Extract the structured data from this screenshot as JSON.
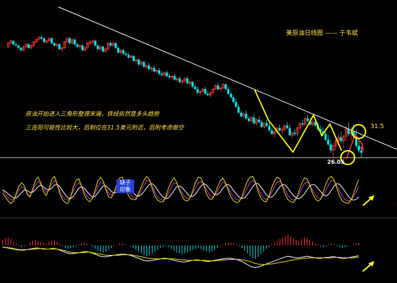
{
  "title": "美原油日线图 —— 于韦斌",
  "annotations": {
    "line1": "原油开始进入三角形整理末端，铁线依然是多头趋势",
    "line2": "三连阳可能性比较大，后制位在31.5美元附近，后附考虑做空"
  },
  "levels": {
    "resistance": "31.5",
    "support": "26.05"
  },
  "badge": {
    "top": "缺子",
    "bottom": "印象"
  },
  "colors": {
    "background": "#000000",
    "up_candle": "#ff3b3b",
    "down_candle": "#00e5e5",
    "trendline": "#ffffff",
    "zigzag": "#ffff00",
    "text": "#ffe14a",
    "gridline": "#7a0000",
    "kdj_k": "#cc33cc",
    "kdj_d": "#ffffff",
    "kdj_j": "#e6e600",
    "macd_pos": "#ff3b3b",
    "macd_neg": "#00e5e5",
    "arrow": "#ffff00"
  },
  "chart_data": {
    "type": "candlestick",
    "candles": [
      [
        4,
        8,
        3,
        7
      ],
      [
        7,
        10,
        6,
        9
      ],
      [
        9,
        9,
        5,
        6
      ],
      [
        6,
        8,
        4,
        5
      ],
      [
        5,
        6,
        2,
        3
      ],
      [
        3,
        4,
        0,
        1
      ],
      [
        1,
        5,
        0,
        4
      ],
      [
        4,
        7,
        3,
        6
      ],
      [
        6,
        7,
        2,
        3
      ],
      [
        3,
        6,
        2,
        5
      ],
      [
        5,
        9,
        4,
        8
      ],
      [
        8,
        11,
        7,
        10
      ],
      [
        10,
        13,
        9,
        12
      ],
      [
        12,
        14,
        10,
        11
      ],
      [
        11,
        12,
        7,
        8
      ],
      [
        8,
        10,
        6,
        9
      ],
      [
        9,
        12,
        8,
        11
      ],
      [
        11,
        12,
        6,
        7
      ],
      [
        7,
        8,
        4,
        5
      ],
      [
        5,
        7,
        3,
        6
      ],
      [
        6,
        7,
        1,
        2
      ],
      [
        2,
        4,
        0,
        3
      ],
      [
        3,
        9,
        2,
        8
      ],
      [
        8,
        12,
        7,
        11
      ],
      [
        11,
        12,
        6,
        7
      ],
      [
        7,
        11,
        6,
        10
      ],
      [
        10,
        11,
        5,
        6
      ],
      [
        6,
        7,
        3,
        4
      ],
      [
        4,
        6,
        2,
        5
      ],
      [
        5,
        6,
        0,
        1
      ],
      [
        1,
        4,
        0,
        3
      ],
      [
        3,
        8,
        2,
        7
      ],
      [
        7,
        9,
        5,
        8
      ],
      [
        8,
        10,
        6,
        9
      ],
      [
        9,
        10,
        4,
        5
      ],
      [
        5,
        6,
        1,
        2
      ],
      [
        2,
        5,
        1,
        4
      ],
      [
        4,
        5,
        -1,
        0
      ],
      [
        0,
        3,
        -1,
        2
      ],
      [
        2,
        8,
        1,
        7
      ],
      [
        7,
        9,
        4,
        5
      ],
      [
        5,
        8,
        4,
        7
      ],
      [
        7,
        8,
        2,
        3
      ],
      [
        3,
        4,
        -2,
        -1
      ],
      [
        -1,
        2,
        -2,
        1
      ],
      [
        1,
        2,
        -3,
        -2
      ],
      [
        -2,
        0,
        -4,
        -3
      ],
      [
        -3,
        -1,
        -6,
        -5
      ],
      [
        -5,
        -3,
        -6,
        -4
      ],
      [
        -4,
        -3,
        -9,
        -8
      ],
      [
        -8,
        -6,
        -10,
        -7
      ],
      [
        -7,
        -6,
        -12,
        -11
      ],
      [
        -11,
        -8,
        -12,
        -9
      ],
      [
        -9,
        -8,
        -14,
        -13
      ],
      [
        -13,
        -11,
        -15,
        -12
      ],
      [
        -12,
        -10,
        -16,
        -15
      ],
      [
        -15,
        -13,
        -17,
        -14
      ],
      [
        -14,
        -12,
        -18,
        -17
      ],
      [
        -17,
        -15,
        -19,
        -16
      ],
      [
        -16,
        -14,
        -20,
        -19
      ],
      [
        -19,
        -17,
        -21,
        -20
      ],
      [
        -20,
        -17,
        -22,
        -18
      ],
      [
        -18,
        -16,
        -22,
        -21
      ],
      [
        -21,
        -19,
        -23,
        -22
      ],
      [
        -22,
        -20,
        -24,
        -21
      ],
      [
        -21,
        -19,
        -25,
        -24
      ],
      [
        -24,
        -22,
        -26,
        -23
      ],
      [
        -23,
        -21,
        -27,
        -26
      ],
      [
        -26,
        -24,
        -28,
        -25
      ],
      [
        -25,
        -22,
        -27,
        -23
      ],
      [
        -23,
        -21,
        -28,
        -27
      ],
      [
        -27,
        -25,
        -29,
        -26
      ],
      [
        -26,
        -25,
        -31,
        -30
      ],
      [
        -30,
        -28,
        -33,
        -32
      ],
      [
        -32,
        -30,
        -36,
        -35
      ],
      [
        -35,
        -33,
        -37,
        -34
      ],
      [
        -34,
        -31,
        -35,
        -32
      ],
      [
        -32,
        -30,
        -37,
        -36
      ],
      [
        -36,
        -34,
        -38,
        -37
      ],
      [
        -37,
        -34,
        -39,
        -35
      ],
      [
        -35,
        -31,
        -36,
        -32
      ],
      [
        -32,
        -28,
        -33,
        -29
      ],
      [
        -29,
        -27,
        -33,
        -32
      ],
      [
        -32,
        -30,
        -34,
        -31
      ],
      [
        -31,
        -27,
        -32,
        -28
      ],
      [
        -28,
        -27,
        -33,
        -32
      ],
      [
        -32,
        -30,
        -37,
        -36
      ],
      [
        -36,
        -34,
        -40,
        -39
      ],
      [
        -39,
        -37,
        -44,
        -43
      ],
      [
        -43,
        -40,
        -48,
        -47
      ],
      [
        -47,
        -45,
        -53,
        -52
      ],
      [
        -52,
        -50,
        -56,
        -55
      ],
      [
        -55,
        -52,
        -57,
        -53
      ],
      [
        -53,
        -50,
        -58,
        -57
      ],
      [
        -57,
        -55,
        -60,
        -59
      ],
      [
        -59,
        -55,
        -60,
        -56
      ],
      [
        -56,
        -53,
        -62,
        -61
      ],
      [
        -61,
        -57,
        -63,
        -58
      ],
      [
        -58,
        -55,
        -61,
        -60
      ],
      [
        -60,
        -58,
        -65,
        -64
      ],
      [
        -64,
        -60,
        -66,
        -61
      ],
      [
        -61,
        -58,
        -64,
        -63
      ],
      [
        -63,
        -60,
        -68,
        -67
      ],
      [
        -67,
        -65,
        -71,
        -70
      ],
      [
        -70,
        -67,
        -73,
        -68
      ],
      [
        -68,
        -64,
        -70,
        -65
      ],
      [
        -65,
        -62,
        -68,
        -67
      ],
      [
        -67,
        -64,
        -70,
        -66
      ],
      [
        -66,
        -62,
        -68,
        -63
      ],
      [
        -63,
        -60,
        -66,
        -65
      ],
      [
        -65,
        -62,
        -72,
        -71
      ],
      [
        -71,
        -68,
        -74,
        -69
      ],
      [
        -69,
        -66,
        -72,
        -70
      ],
      [
        -70,
        -64,
        -72,
        -65
      ],
      [
        -65,
        -60,
        -67,
        -61
      ],
      [
        -61,
        -58,
        -64,
        -62
      ],
      [
        -62,
        -56,
        -63,
        -57
      ],
      [
        -57,
        -54,
        -60,
        -59
      ],
      [
        -59,
        -57,
        -63,
        -62
      ],
      [
        -62,
        -58,
        -64,
        -60
      ],
      [
        -60,
        -57,
        -64,
        -63
      ],
      [
        -63,
        -60,
        -68,
        -66
      ],
      [
        -66,
        -63,
        -70,
        -68
      ],
      [
        -68,
        -64,
        -72,
        -70
      ],
      [
        -70,
        -66,
        -76,
        -75
      ],
      [
        -75,
        -71,
        -80,
        -79
      ],
      [
        -79,
        -75,
        -86,
        -84
      ],
      [
        -84,
        -78,
        -90,
        -80
      ],
      [
        -80,
        -74,
        -84,
        -76
      ],
      [
        -76,
        -70,
        -80,
        -73
      ],
      [
        -73,
        -68,
        -78,
        -76
      ],
      [
        -76,
        -71,
        -82,
        -72
      ],
      [
        -72,
        -64,
        -76,
        -66
      ],
      [
        -66,
        -60,
        -72,
        -70
      ],
      [
        -70,
        -64,
        -76,
        -68
      ],
      [
        -68,
        -62,
        -74,
        -72
      ],
      [
        -72,
        -66,
        -82,
        -80
      ],
      [
        -80,
        -76,
        -86,
        -84
      ],
      [
        -84,
        -80,
        -90,
        -86
      ]
    ],
    "kdj": {
      "k": [
        46,
        38,
        28,
        22,
        24,
        34,
        48,
        56,
        52,
        40,
        34,
        44,
        60,
        70,
        62,
        50,
        42,
        48,
        62,
        72,
        62,
        46,
        32,
        24,
        22,
        30,
        46,
        60,
        66,
        58,
        44,
        32,
        26,
        28,
        40,
        56,
        68,
        64,
        52,
        40,
        34,
        40,
        52,
        64,
        70,
        62,
        48,
        36,
        30,
        28,
        34,
        46,
        60,
        72,
        70,
        58,
        42,
        30,
        24,
        22,
        28,
        40,
        54,
        66,
        64,
        52,
        40,
        30,
        26,
        30,
        40,
        54,
        66,
        70,
        62,
        48,
        36,
        30,
        34,
        44,
        58,
        68,
        64,
        52,
        40,
        30,
        24,
        22,
        28,
        40,
        54,
        66,
        72,
        66,
        52,
        38,
        28,
        24,
        30,
        42,
        56,
        68,
        70,
        60,
        46,
        34,
        26,
        22,
        26,
        36,
        50,
        64,
        68,
        62,
        48,
        36,
        28,
        26,
        34,
        48,
        62,
        72,
        70,
        58,
        44,
        32,
        24,
        20,
        22,
        30,
        42,
        56
      ],
      "d": [
        48,
        44,
        38,
        32,
        28,
        28,
        34,
        42,
        48,
        46,
        42,
        42,
        48,
        56,
        60,
        56,
        50,
        48,
        52,
        60,
        62,
        56,
        46,
        36,
        28,
        26,
        32,
        42,
        52,
        56,
        52,
        44,
        36,
        30,
        32,
        40,
        50,
        58,
        58,
        52,
        44,
        40,
        42,
        50,
        58,
        62,
        58,
        50,
        42,
        34,
        32,
        36,
        44,
        54,
        62,
        64,
        58,
        48,
        38,
        30,
        26,
        28,
        36,
        46,
        56,
        58,
        54,
        46,
        38,
        32,
        32,
        38,
        48,
        58,
        64,
        60,
        52,
        44,
        36,
        36,
        42,
        52,
        60,
        62,
        56,
        46,
        38,
        30,
        26,
        28,
        36,
        46,
        56,
        64,
        64,
        56,
        46,
        36,
        30,
        30,
        36,
        46,
        56,
        62,
        60,
        52,
        42,
        34,
        28,
        26,
        30,
        38,
        48,
        58,
        62,
        60,
        52,
        44,
        36,
        32,
        38,
        48,
        58,
        64,
        62,
        54,
        44,
        34,
        26,
        22,
        24,
        30
      ],
      "j": [
        40,
        30,
        20,
        14,
        20,
        40,
        58,
        66,
        58,
        36,
        30,
        50,
        72,
        80,
        66,
        44,
        34,
        50,
        74,
        82,
        64,
        38,
        24,
        16,
        14,
        30,
        56,
        72,
        76,
        58,
        36,
        24,
        18,
        26,
        48,
        70,
        80,
        70,
        48,
        30,
        28,
        42,
        62,
        78,
        80,
        62,
        38,
        26,
        24,
        24,
        40,
        56,
        72,
        82,
        74,
        52,
        32,
        22,
        18,
        18,
        30,
        52,
        68,
        78,
        68,
        48,
        32,
        22,
        20,
        28,
        48,
        68,
        80,
        78,
        60,
        38,
        26,
        24,
        36,
        54,
        70,
        78,
        66,
        46,
        30,
        20,
        16,
        18,
        30,
        52,
        70,
        80,
        82,
        68,
        44,
        28,
        20,
        18,
        32,
        54,
        70,
        80,
        76,
        56,
        36,
        24,
        18,
        16,
        26,
        44,
        64,
        78,
        76,
        60,
        40,
        26,
        20,
        24,
        44,
        64,
        78,
        82,
        72,
        52,
        32,
        20,
        16,
        14,
        20,
        36,
        56,
        74
      ]
    },
    "macd": {
      "hist": [
        6,
        8,
        9,
        7,
        4,
        2,
        -1,
        -2,
        -1,
        1,
        3,
        5,
        6,
        5,
        4,
        3,
        2,
        4,
        5,
        6,
        4,
        2,
        -1,
        -3,
        -4,
        -3,
        -2,
        -1,
        1,
        2,
        3,
        2,
        1,
        -2,
        -4,
        -6,
        -7,
        -8,
        -7,
        -5,
        -3,
        -1,
        1,
        2,
        2,
        1,
        0,
        -1,
        -3,
        -5,
        -7,
        -9,
        -11,
        -12,
        -11,
        -9,
        -7,
        -5,
        -3,
        -2,
        -1,
        -2,
        -4,
        -6,
        -8,
        -9,
        -10,
        -9,
        -8,
        -6,
        -5,
        -4,
        -3,
        -4,
        -6,
        -7,
        -8,
        -7,
        -5,
        -3,
        -1,
        1,
        2,
        3,
        3,
        2,
        1,
        -1,
        -3,
        -6,
        -9,
        -12,
        -14,
        -15,
        -13,
        -10,
        -7,
        -4,
        -2,
        1,
        3,
        5,
        7,
        9,
        11,
        12,
        10,
        8,
        6,
        5,
        7,
        9,
        8,
        6,
        4,
        2,
        1,
        -1,
        -2,
        -1,
        1,
        2,
        1,
        -1,
        -2,
        -3,
        -2,
        -1,
        0,
        1,
        2,
        3
      ],
      "dif": [
        10,
        9,
        8,
        7,
        6,
        5,
        4,
        4,
        4,
        5,
        6,
        7,
        8,
        8,
        7,
        6,
        6,
        6,
        7,
        7,
        6,
        4,
        2,
        0,
        -2,
        -3,
        -3,
        -2,
        -1,
        0,
        1,
        1,
        0,
        -2,
        -4,
        -6,
        -8,
        -9,
        -9,
        -8,
        -7,
        -6,
        -5,
        -4,
        -4,
        -4,
        -5,
        -6,
        -8,
        -10,
        -12,
        -14,
        -16,
        -17,
        -17,
        -16,
        -15,
        -14,
        -13,
        -12,
        -12,
        -13,
        -14,
        -16,
        -17,
        -18,
        -19,
        -19,
        -18,
        -17,
        -16,
        -15,
        -15,
        -16,
        -17,
        -18,
        -18,
        -17,
        -16,
        -15,
        -14,
        -13,
        -12,
        -12,
        -12,
        -13,
        -14,
        -16,
        -18,
        -21,
        -24,
        -27,
        -29,
        -30,
        -29,
        -27,
        -25,
        -23,
        -21,
        -19,
        -17,
        -15,
        -13,
        -11,
        -9,
        -8,
        -9,
        -10,
        -11,
        -11,
        -10,
        -9,
        -8,
        -9,
        -10,
        -11,
        -12,
        -12,
        -11,
        -10,
        -10,
        -9,
        -9,
        -10,
        -11,
        -12,
        -12,
        -11,
        -10,
        -9,
        -8,
        -7
      ],
      "dea": [
        9,
        9,
        9,
        8,
        7,
        6,
        5,
        5,
        5,
        5,
        5,
        6,
        6,
        7,
        7,
        7,
        6,
        6,
        6,
        6,
        6,
        5,
        4,
        3,
        1,
        0,
        -1,
        -1,
        -1,
        -1,
        -1,
        0,
        0,
        -1,
        -2,
        -3,
        -4,
        -5,
        -6,
        -6,
        -6,
        -6,
        -6,
        -6,
        -5,
        -5,
        -5,
        -5,
        -6,
        -7,
        -8,
        -9,
        -10,
        -11,
        -12,
        -13,
        -13,
        -13,
        -13,
        -13,
        -13,
        -13,
        -13,
        -13,
        -14,
        -14,
        -15,
        -15,
        -16,
        -16,
        -16,
        -16,
        -16,
        -16,
        -16,
        -16,
        -17,
        -17,
        -17,
        -16,
        -16,
        -15,
        -15,
        -14,
        -14,
        -14,
        -14,
        -14,
        -15,
        -16,
        -17,
        -18,
        -20,
        -22,
        -23,
        -24,
        -24,
        -24,
        -23,
        -23,
        -22,
        -21,
        -20,
        -19,
        -18,
        -17,
        -16,
        -15,
        -14,
        -13,
        -13,
        -12,
        -12,
        -11,
        -11,
        -11,
        -11,
        -11,
        -11,
        -11,
        -11,
        -11,
        -10,
        -10,
        -10,
        -11,
        -11,
        -11,
        -11,
        -11,
        -10,
        -10
      ]
    }
  }
}
